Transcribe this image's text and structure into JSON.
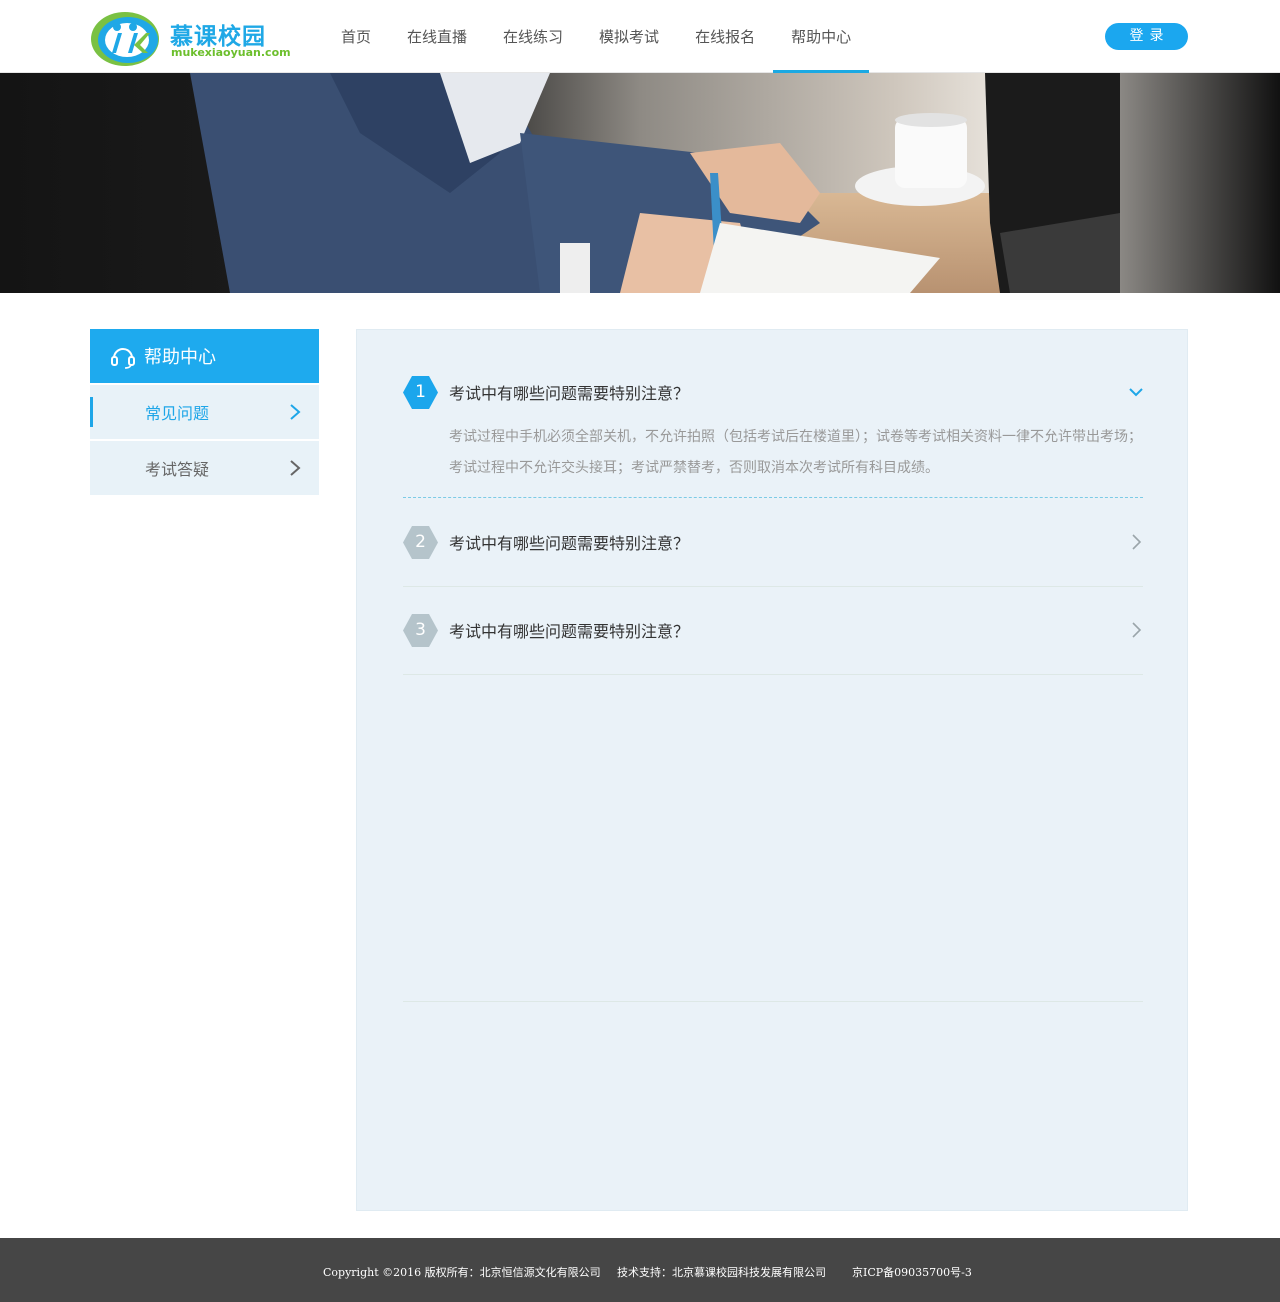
{
  "header": {
    "logo_title": "慕课校园",
    "logo_subtitle": "mukexiaoyuan.com",
    "nav": [
      {
        "label": "首页",
        "active": false
      },
      {
        "label": "在线直播",
        "active": false
      },
      {
        "label": "在线练习",
        "active": false
      },
      {
        "label": "模拟考试",
        "active": false
      },
      {
        "label": "在线报名",
        "active": false
      },
      {
        "label": "帮助中心",
        "active": true
      }
    ],
    "login_label": "登录"
  },
  "sidebar": {
    "title": "帮助中心",
    "items": [
      {
        "label": "常见问题",
        "active": true
      },
      {
        "label": "考试答疑",
        "active": false
      }
    ]
  },
  "faq": [
    {
      "num": "1",
      "question": "考试中有哪些问题需要特别注意？",
      "expanded": true,
      "answer": "考试过程中手机必须全部关机，不允许拍照（包括考试后在楼道里）；试卷等考试相关资料一律不允许带出考场；考试过程中不允许交头接耳；考试严禁替考，否则取消本次考试所有科目成绩。"
    },
    {
      "num": "2",
      "question": "考试中有哪些问题需要特别注意？",
      "expanded": false
    },
    {
      "num": "3",
      "question": "考试中有哪些问题需要特别注意？",
      "expanded": false
    }
  ],
  "footer": {
    "copyright": "Copyright ©2016 版权所有：北京恒信源文化有限公司",
    "support": "技术支持：北京慕课校园科技发展有限公司",
    "icp": "京ICP备09035700号-3"
  },
  "colors": {
    "accent": "#1ea6e8",
    "hex_active": "#1ba6ec",
    "hex_inactive": "#b5c4cb",
    "footer_bg": "#464646"
  }
}
